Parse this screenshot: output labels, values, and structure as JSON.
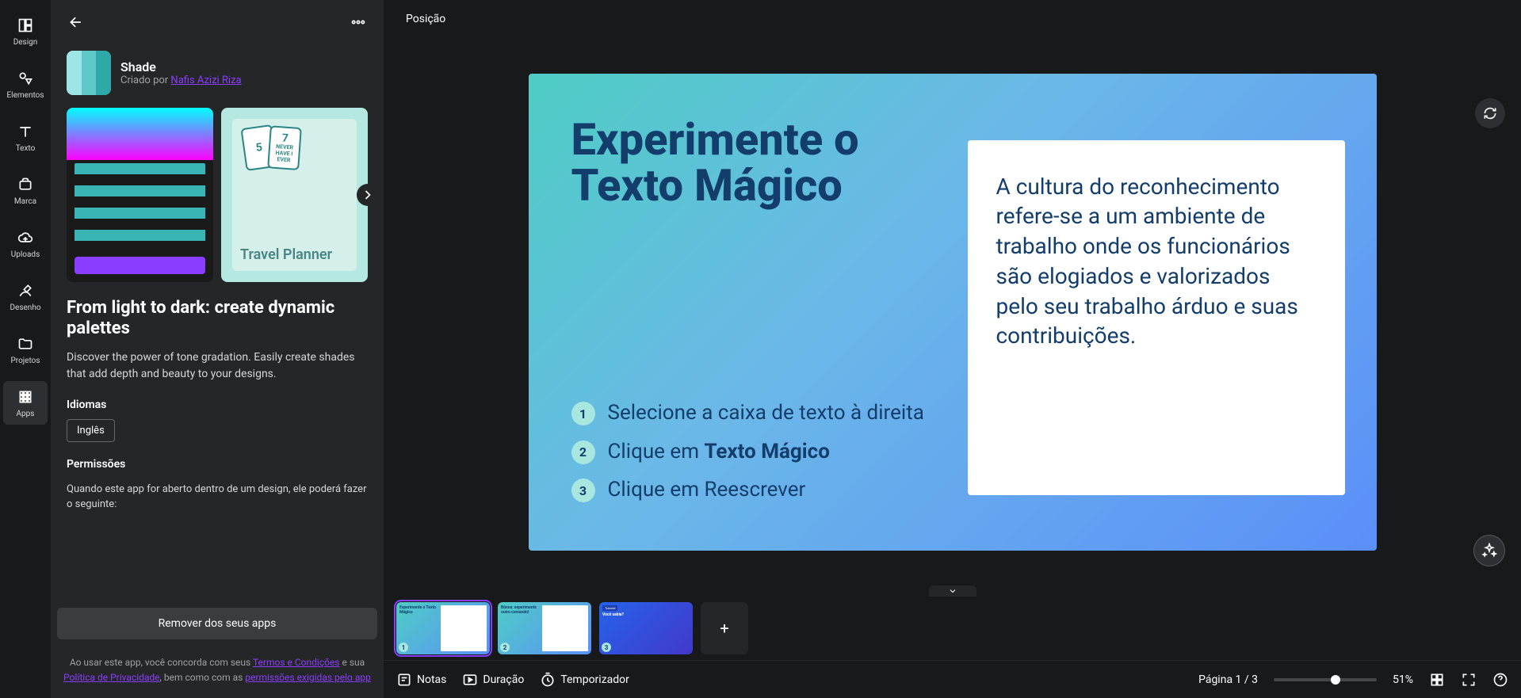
{
  "rail": {
    "design": "Design",
    "elementos": "Elementos",
    "texto": "Texto",
    "marca": "Marca",
    "uploads": "Uploads",
    "desenho": "Desenho",
    "projetos": "Projetos",
    "apps": "Apps"
  },
  "panel": {
    "app_name": "Shade",
    "created_by_prefix": "Criado por ",
    "author": "Nafis Azizi Riza",
    "gallery": {
      "card1": "5",
      "card2": "7",
      "never_line1": "NEVER",
      "never_line2": "HAVE I EVER",
      "travel": "Travel Planner"
    },
    "headline": "From light to dark: create dynamic palettes",
    "desc": "Discover the power of tone gradation. Easily create shades that add depth and beauty to your designs.",
    "idiomas_label": "Idiomas",
    "lang": "Inglês",
    "perm_label": "Permissões",
    "perm_text": "Quando este app for aberto dentro de um design, ele poderá fazer o seguinte:",
    "remove_btn": "Remover dos seus apps",
    "legal_prefix": "Ao usar este app, você concorda com seus ",
    "legal_terms": "Termos e Condições",
    "legal_and": " e sua ",
    "legal_privacy": "Política de Privacidade",
    "legal_also": ", bem como com as ",
    "legal_app_perms": "permissões exigidas pelo app"
  },
  "toolbar": {
    "posicao": "Posição"
  },
  "slide": {
    "title": "Experimente o Texto Mágico",
    "step1": "Selecione a caixa de texto à direita",
    "step2a": "Clique em ",
    "step2b": "Texto Mágico",
    "step3": "Clique em Reescrever",
    "body": "A cultura do reconhecimento refere-se a um ambiente de trabalho onde os funcionários são elogiados e valorizados pelo seu trabalho árduo e suas contribuições."
  },
  "thumbs": {
    "t1_title": "Experimente o Texto Mágico",
    "t2_title": "Bônus: experimente outro comando!",
    "t3_badge": "Tutorial",
    "t3_title": "Você sabia?"
  },
  "footer": {
    "notas": "Notas",
    "duracao": "Duração",
    "temporizador": "Temporizador",
    "page": "Página 1 / 3",
    "zoom": "51%"
  }
}
